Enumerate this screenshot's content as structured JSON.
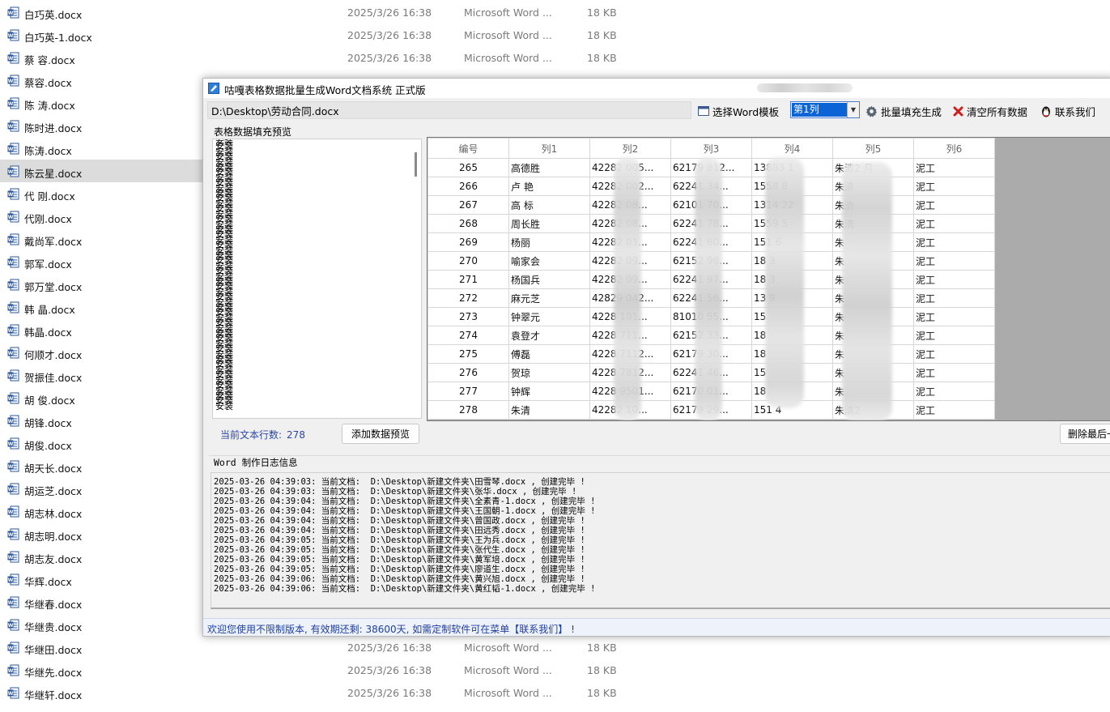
{
  "explorer": {
    "files": [
      {
        "name": "白巧英.docx",
        "date": "2025/3/26 16:38",
        "type": "Microsoft Word ...",
        "size": "18 KB"
      },
      {
        "name": "白巧英-1.docx",
        "date": "2025/3/26 16:38",
        "type": "Microsoft Word ...",
        "size": "18 KB"
      },
      {
        "name": "蔡 容.docx",
        "date": "2025/3/26 16:38",
        "type": "Microsoft Word ...",
        "size": "18 KB"
      },
      {
        "name": "蔡容.docx",
        "date": "",
        "type": "",
        "size": ""
      },
      {
        "name": "陈 涛.docx",
        "date": "",
        "type": "",
        "size": ""
      },
      {
        "name": "陈时进.docx",
        "date": "",
        "type": "",
        "size": ""
      },
      {
        "name": "陈涛.docx",
        "date": "",
        "type": "",
        "size": ""
      },
      {
        "name": "陈云星.docx",
        "date": "",
        "type": "",
        "size": ""
      },
      {
        "name": "代 刚.docx",
        "date": "",
        "type": "",
        "size": ""
      },
      {
        "name": "代刚.docx",
        "date": "",
        "type": "",
        "size": ""
      },
      {
        "name": "戴尚军.docx",
        "date": "",
        "type": "",
        "size": ""
      },
      {
        "name": "郭军.docx",
        "date": "",
        "type": "",
        "size": ""
      },
      {
        "name": "郭万堂.docx",
        "date": "",
        "type": "",
        "size": ""
      },
      {
        "name": "韩 晶.docx",
        "date": "",
        "type": "",
        "size": ""
      },
      {
        "name": "韩晶.docx",
        "date": "",
        "type": "",
        "size": ""
      },
      {
        "name": "何顺才.docx",
        "date": "",
        "type": "",
        "size": ""
      },
      {
        "name": "贺振佳.docx",
        "date": "",
        "type": "",
        "size": ""
      },
      {
        "name": "胡 俊.docx",
        "date": "",
        "type": "",
        "size": ""
      },
      {
        "name": "胡锋.docx",
        "date": "",
        "type": "",
        "size": ""
      },
      {
        "name": "胡俊.docx",
        "date": "",
        "type": "",
        "size": ""
      },
      {
        "name": "胡天长.docx",
        "date": "",
        "type": "",
        "size": ""
      },
      {
        "name": "胡运芝.docx",
        "date": "",
        "type": "",
        "size": ""
      },
      {
        "name": "胡志林.docx",
        "date": "",
        "type": "",
        "size": ""
      },
      {
        "name": "胡志明.docx",
        "date": "",
        "type": "",
        "size": ""
      },
      {
        "name": "胡志友.docx",
        "date": "",
        "type": "",
        "size": ""
      },
      {
        "name": "华辉.docx",
        "date": "",
        "type": "",
        "size": ""
      },
      {
        "name": "华继春.docx",
        "date": "",
        "type": "",
        "size": ""
      },
      {
        "name": "华继贵.docx",
        "date": "",
        "type": "",
        "size": ""
      },
      {
        "name": "华继田.docx",
        "date": "2025/3/26 16:38",
        "type": "Microsoft Word ...",
        "size": "18 KB"
      },
      {
        "name": "华继先.docx",
        "date": "2025/3/26 16:38",
        "type": "Microsoft Word ...",
        "size": "18 KB"
      },
      {
        "name": "华继轩.docx",
        "date": "2025/3/26 16:38",
        "type": "Microsoft Word ...",
        "size": "18 KB"
      }
    ],
    "selected_index": 7,
    "icon": "word-document-icon",
    "icon_color": "#2b579a"
  },
  "app": {
    "title": "咕嘎表格数据批量生成Word文档系统   正式版",
    "path_value": "D:\\Desktop\\劳动合同.docx",
    "toolbar": {
      "select_template": "选择Word模板",
      "column_select": "第1列",
      "batch_fill": "批量填充生成",
      "clear_all": "清空所有数据",
      "contact": "联系我们"
    },
    "preview_label": "表格数据填充预览",
    "text_list_item": "安装",
    "text_list_count": 52,
    "grid": {
      "headers": [
        "编号",
        "列1",
        "列2",
        "列3",
        "列4",
        "列5",
        "列6"
      ],
      "rows": [
        [
          "265",
          "高德胜",
          "42282 005...",
          "62179 812...",
          "13883 1",
          "朱清2 月",
          "泥工"
        ],
        [
          "266",
          "卢 艳",
          "42282 002...",
          "62241 34...",
          "1558 8",
          "朱清",
          "泥工"
        ],
        [
          "267",
          "高 标",
          "42282 08...",
          "62101 70...",
          "1314 22",
          "朱清",
          "泥工"
        ],
        [
          "268",
          "周长胜",
          "42282 08...",
          "62241 78...",
          "1559 5",
          "朱清",
          "泥工"
        ],
        [
          "269",
          "杨丽",
          "42282 01...",
          "62241 60...",
          "151 6",
          "朱",
          "泥工"
        ],
        [
          "270",
          "喻家会",
          "42282 09...",
          "62152 96...",
          "18 3",
          "朱",
          "泥工"
        ],
        [
          "271",
          "杨国兵",
          "42282 09...",
          "62241 97...",
          "18 3",
          "朱",
          "泥工"
        ],
        [
          "272",
          "麻元芝",
          "42829 042...",
          "62241 56...",
          "13 9",
          "朱",
          "泥工"
        ],
        [
          "273",
          "钟翠元",
          "4228 101...",
          "81010 55...",
          "15",
          "朱",
          "泥工"
        ],
        [
          "274",
          "袁登才",
          "4228 711...",
          "62152 33...",
          "18",
          "朱",
          "泥工"
        ],
        [
          "275",
          "傅磊",
          "4228 7112...",
          "62179 30...",
          "18",
          "朱",
          "泥工"
        ],
        [
          "276",
          "贺琼",
          "4228 7812...",
          "62241 46...",
          "15",
          "朱",
          "泥工"
        ],
        [
          "277",
          "钟辉",
          "4228 9501...",
          "62170 01...",
          "18",
          "朱",
          "泥工"
        ],
        [
          "278",
          "朱清",
          "42282 10...",
          "62179 29...",
          "151 4",
          "朱清2",
          "泥工"
        ]
      ]
    },
    "count_label": "当前文本行数:",
    "count_value": "278",
    "add_preview_btn": "添加数据预览",
    "delete_last_btn": "删除最后一",
    "log_label": "Word 制作日志信息",
    "log_lines": [
      "2025-03-26 04:39:03: 当前文档:  D:\\Desktop\\新建文件夹\\田雪琴.docx , 创建完毕 !",
      "2025-03-26 04:39:03: 当前文档:  D:\\Desktop\\新建文件夹\\张华.docx , 创建完毕 !",
      "2025-03-26 04:39:04: 当前文档:  D:\\Desktop\\新建文件夹\\全素青-1.docx , 创建完毕 !",
      "2025-03-26 04:39:04: 当前文档:  D:\\Desktop\\新建文件夹\\王国朝-1.docx , 创建完毕 !",
      "2025-03-26 04:39:04: 当前文档:  D:\\Desktop\\新建文件夹\\曾国政.docx , 创建完毕 !",
      "2025-03-26 04:39:04: 当前文档:  D:\\Desktop\\新建文件夹\\田远秀.docx , 创建完毕 !",
      "2025-03-26 04:39:05: 当前文档:  D:\\Desktop\\新建文件夹\\王为兵.docx , 创建完毕 !",
      "2025-03-26 04:39:05: 当前文档:  D:\\Desktop\\新建文件夹\\张代生.docx , 创建完毕 !",
      "2025-03-26 04:39:05: 当前文档:  D:\\Desktop\\新建文件夹\\黄军培.docx , 创建完毕 !",
      "2025-03-26 04:39:05: 当前文档:  D:\\Desktop\\新建文件夹\\廖道生.docx , 创建完毕 !",
      "2025-03-26 04:39:06: 当前文档:  D:\\Desktop\\新建文件夹\\黄兴旭.docx , 创建完毕 !",
      "2025-03-26 04:39:06: 当前文档:  D:\\Desktop\\新建文件夹\\黄红韬-1.docx , 创建完毕 !"
    ],
    "status_text": "欢迎您使用不限制版本, 有效期还剩: 38600天, 如需定制软件可在菜单【联系我们】 !"
  },
  "colors": {
    "status_text": "#1f3f9f",
    "select_highlight": "#0a64d6",
    "clear_icon": "#d21c1c"
  }
}
